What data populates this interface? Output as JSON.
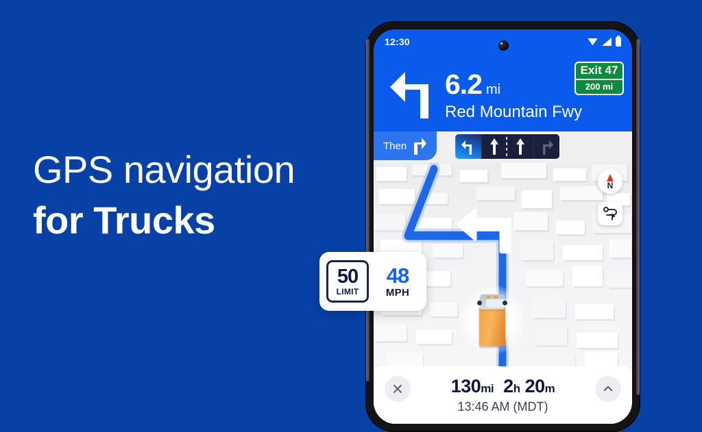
{
  "theme": {
    "background_blue": "#0741a6",
    "nav_blue": "#0a5bec",
    "chip_blue": "#2c74f0",
    "exit_green": "#0e8a3e",
    "accent_speed": "#1763e8",
    "map_bg": "#f3f3f5"
  },
  "marketing": {
    "headline_line1": "GPS navigation",
    "headline_line2": "for Trucks"
  },
  "phone": {
    "status_bar": {
      "time": "12:30",
      "icons": [
        "wifi-icon",
        "signal-icon",
        "battery-icon"
      ]
    },
    "nav_header": {
      "maneuver_icon": "turn-left-arrow-icon",
      "distance_value": "6.2",
      "distance_unit": "mi",
      "road_name": "Red Mountain Fwy",
      "exit_badge": {
        "exit_label": "Exit 47",
        "exit_distance": "200 mi"
      }
    },
    "lane_guidance": {
      "then_label": "Then",
      "then_icon": "turn-right-arrow-icon",
      "lanes": [
        {
          "icon": "lane-turn-left-icon",
          "highlighted": true
        },
        {
          "icon": "lane-straight-icon",
          "highlighted": false
        },
        {
          "icon": "lane-straight-icon",
          "highlighted": false
        },
        {
          "icon": "lane-turn-right-icon",
          "highlighted": false
        }
      ]
    },
    "map": {
      "vehicle_marker": "truck-marker-icon",
      "compass": {
        "icon": "compass-needle-icon",
        "label": "N"
      },
      "route_overview_button": "route-overview-icon"
    },
    "speed_widget": {
      "limit_value": "50",
      "limit_label": "LIMIT",
      "current_value": "48",
      "current_unit": "MPH"
    },
    "trip_bar": {
      "close_icon": "close-icon",
      "expand_icon": "chevron-up-icon",
      "distance_value": "130",
      "distance_unit": "mi",
      "hours_value": "2",
      "hours_unit": "h",
      "minutes_value": "20",
      "minutes_unit": "m",
      "arrival_time": "13:46 AM (MDT)"
    }
  }
}
